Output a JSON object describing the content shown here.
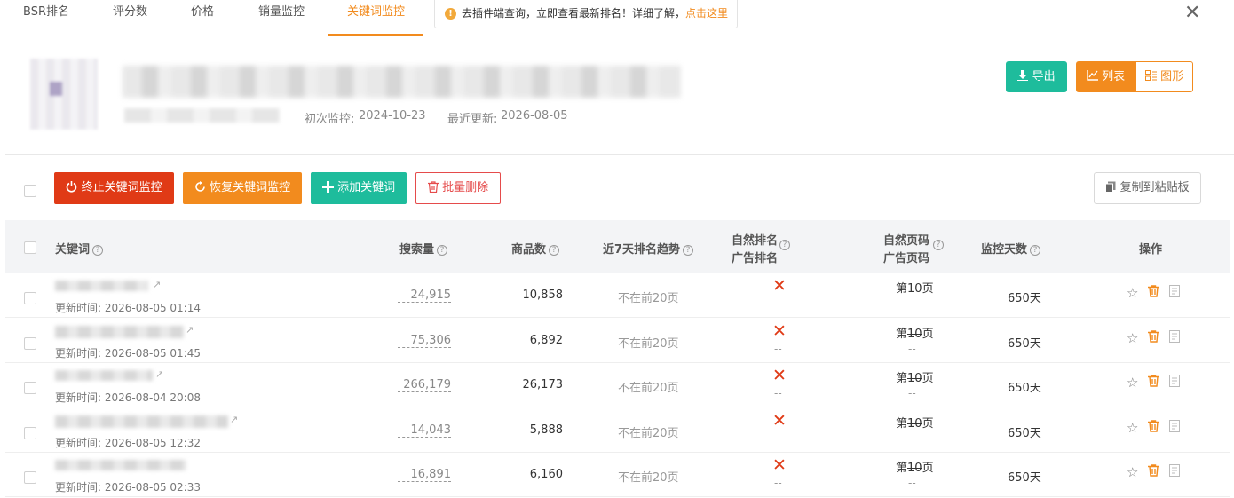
{
  "tabs": [
    {
      "label": "BSR排名"
    },
    {
      "label": "评分数"
    },
    {
      "label": "价格"
    },
    {
      "label": "销量监控"
    },
    {
      "label": "关键词监控"
    }
  ],
  "notice": {
    "text": "去插件端查询，立即查看最新排名！详细了解，",
    "link": "点击这里"
  },
  "product": {
    "first_monitor_label": "初次监控:",
    "first_monitor_date": "2024-10-23",
    "last_update_label": "最近更新:",
    "last_update_date": "2026-08-05"
  },
  "toolbar": {
    "export": "导出",
    "list_view": "列表",
    "graph_view": "图形"
  },
  "actions": {
    "stop": "终止关键词监控",
    "resume": "恢复关键词监控",
    "add": "添加关键词",
    "batch_delete": "批量删除",
    "copy": "复制到粘贴板"
  },
  "columns": {
    "keyword": "关键词",
    "search_volume": "搜索量",
    "product_count": "商品数",
    "trend": "近7天排名趋势",
    "natural_rank": "自然排名",
    "ad_rank": "广告排名",
    "natural_page": "自然页码",
    "ad_page": "广告页码",
    "days": "监控天数",
    "operation": "操作"
  },
  "rows": [
    {
      "updated": "更新时间: 2026-08-05 01:14",
      "search_volume": "24,915",
      "product_count": "10,858",
      "trend": "不在前20页",
      "ad_rank": "--",
      "page_prefix": "第",
      "page_num": "10",
      "page_suffix": "页",
      "ad_page": "--",
      "days": "650天"
    },
    {
      "updated": "更新时间: 2026-08-05 01:45",
      "search_volume": "75,306",
      "product_count": "6,892",
      "trend": "不在前20页",
      "ad_rank": "--",
      "page_prefix": "第",
      "page_num": "10",
      "page_suffix": "页",
      "ad_page": "--",
      "days": "650天"
    },
    {
      "updated": "更新时间: 2026-08-04 20:08",
      "search_volume": "266,179",
      "product_count": "26,173",
      "trend": "不在前20页",
      "ad_rank": "--",
      "page_prefix": "第",
      "page_num": "10",
      "page_suffix": "页",
      "ad_page": "--",
      "days": "650天"
    },
    {
      "updated": "更新时间: 2026-08-05 12:32",
      "search_volume": "14,043",
      "product_count": "5,888",
      "trend": "不在前20页",
      "ad_rank": "--",
      "page_prefix": "第",
      "page_num": "10",
      "page_suffix": "页",
      "ad_page": "--",
      "days": "650天"
    },
    {
      "updated": "更新时间: 2026-08-05 02:33",
      "search_volume": "16,891",
      "product_count": "6,160",
      "trend": "不在前20页",
      "ad_rank": "--",
      "page_prefix": "第",
      "page_num": "10",
      "page_suffix": "页",
      "ad_page": "--",
      "days": "650天"
    }
  ],
  "icons": {
    "warning": "!",
    "close": "✕",
    "export": "download-icon",
    "power": "power-icon",
    "refresh": "refresh-icon",
    "plus": "plus-icon",
    "trash": "trash-icon",
    "copy": "copy-icon",
    "help": "?",
    "not_ranked": "✕",
    "star": "☆",
    "share": "share-icon"
  },
  "colors": {
    "accent": "#f28b1e",
    "teal": "#1ebc9c",
    "red": "#e03a16"
  }
}
